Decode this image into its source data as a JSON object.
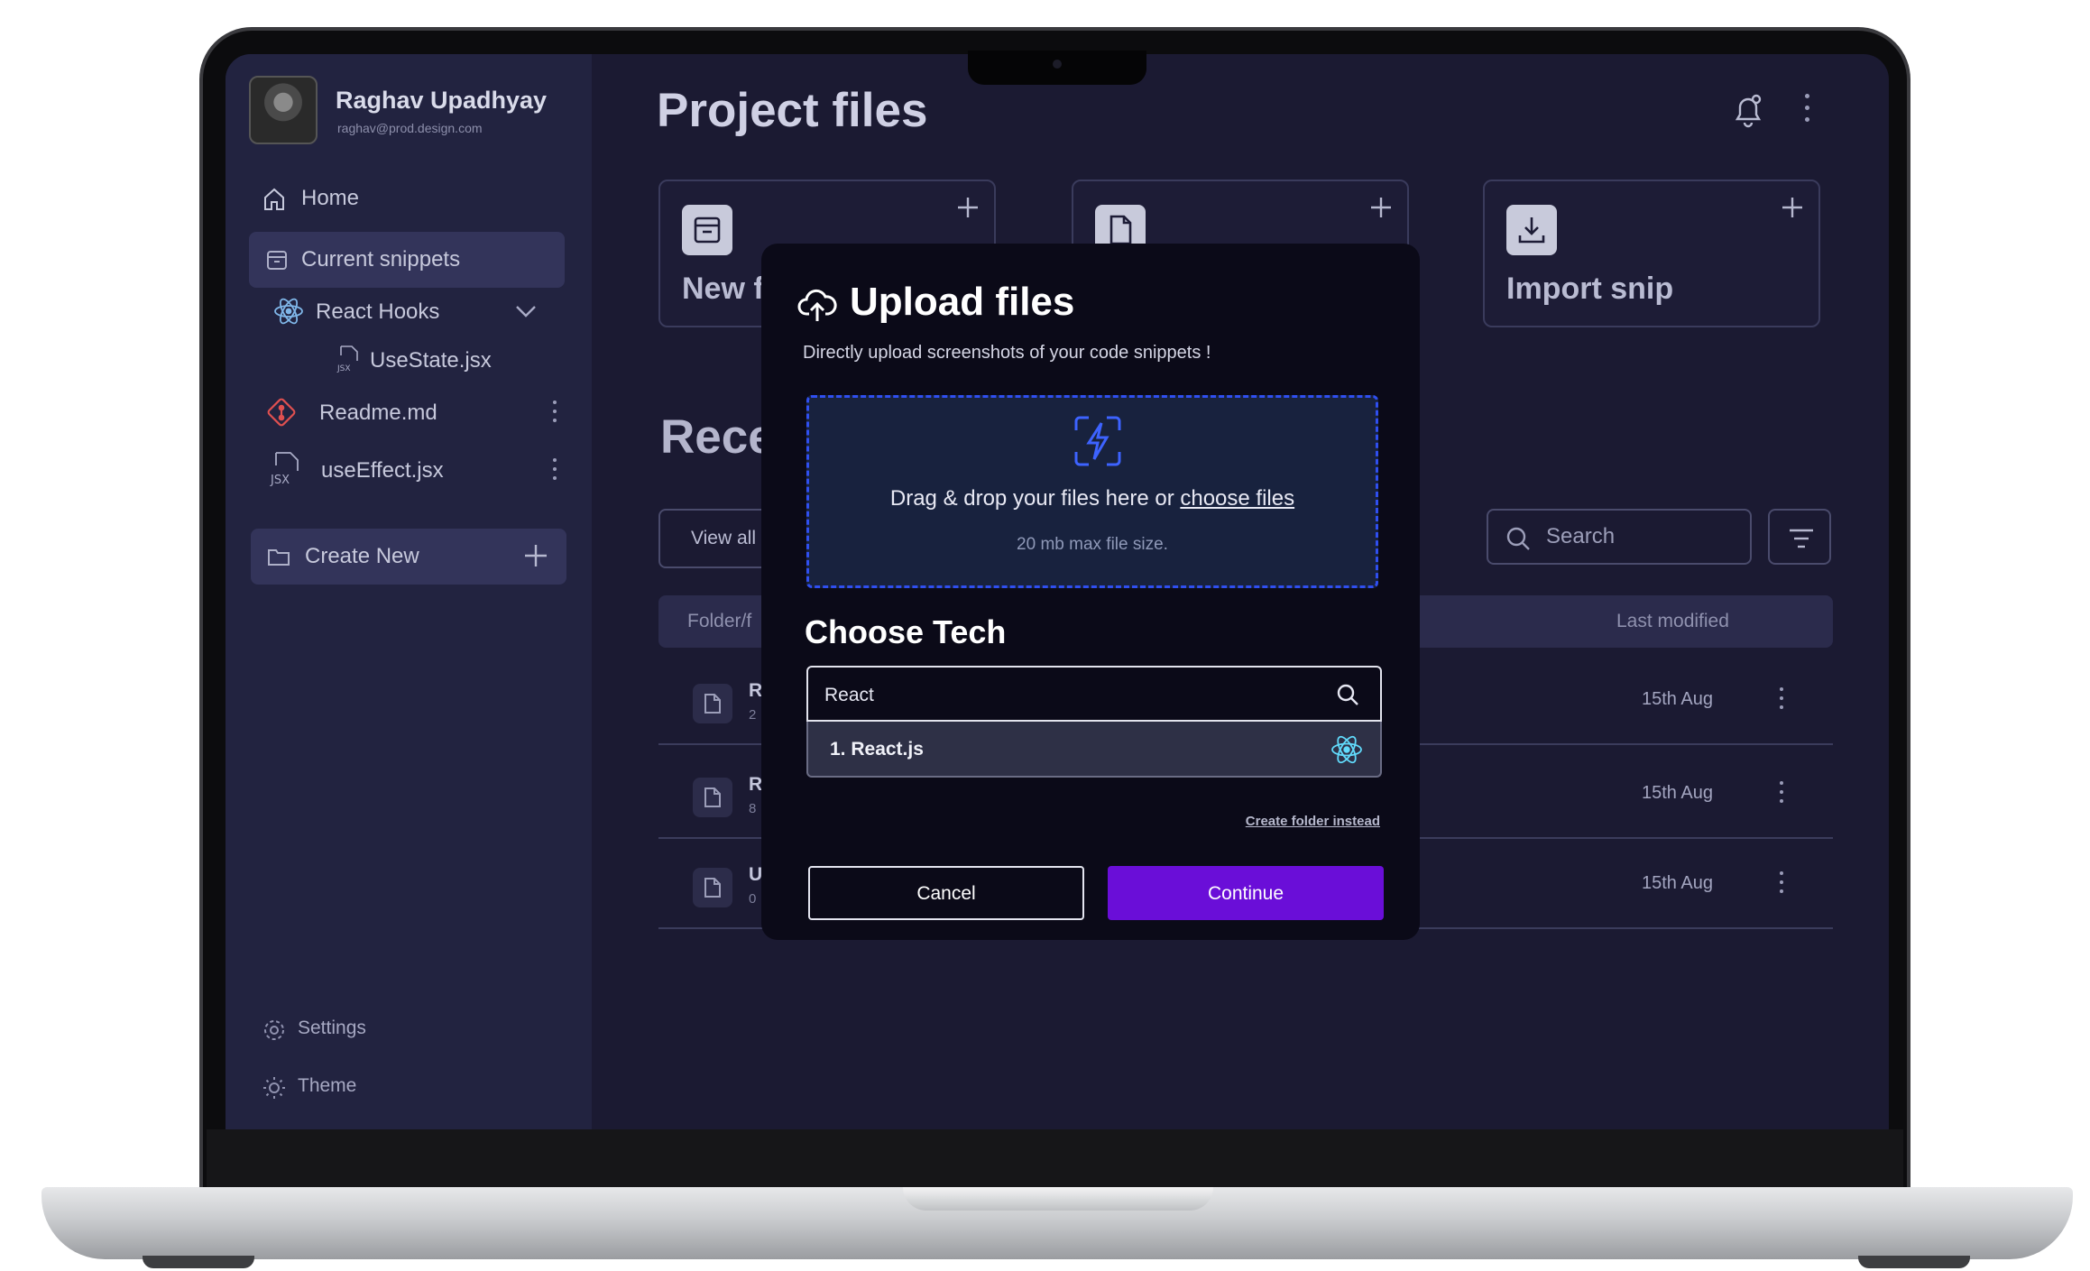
{
  "user": {
    "name": "Raghav Upadhyay",
    "email": "raghav@prod.design.com"
  },
  "sidebar": {
    "home": "Home",
    "current_snippets": "Current snippets",
    "tree": [
      {
        "label": "React Hooks"
      },
      {
        "label": "UseState.jsx"
      },
      {
        "label": "Readme.md"
      },
      {
        "label": "useEffect.jsx"
      }
    ],
    "create_new": "Create New",
    "settings": "Settings",
    "theme": "Theme"
  },
  "main": {
    "title": "Project files",
    "cards": [
      {
        "label": "New f"
      },
      {
        "label": ""
      },
      {
        "label": "Import snip"
      }
    ],
    "section_title": "Rece",
    "view_all": "View all",
    "search_placeholder": "Search",
    "table": {
      "col_name": "Folder/f",
      "col_modified": "Last modified",
      "rows": [
        {
          "name": "R",
          "meta": "2",
          "date": "15th Aug"
        },
        {
          "name": "R",
          "meta": "8",
          "date": "15th Aug"
        },
        {
          "name": "U",
          "meta": "0",
          "date": "15th Aug"
        }
      ]
    }
  },
  "modal": {
    "title": "Upload files",
    "subtitle": "Directly upload screenshots of your code snippets !",
    "drop_text": "Drag & drop your files here or ",
    "drop_link": "choose files",
    "drop_hint": "20 mb max file size.",
    "tech_title": "Choose Tech",
    "tech_value": "React",
    "tech_option": "1. React.js",
    "create_folder": "Create folder instead",
    "cancel": "Cancel",
    "continue": "Continue"
  },
  "colors": {
    "accent": "#6a0ed8",
    "dropzone_border": "#2f4ff0",
    "screen_bg": "#1b1a32",
    "sidebar_bg": "#222340"
  }
}
